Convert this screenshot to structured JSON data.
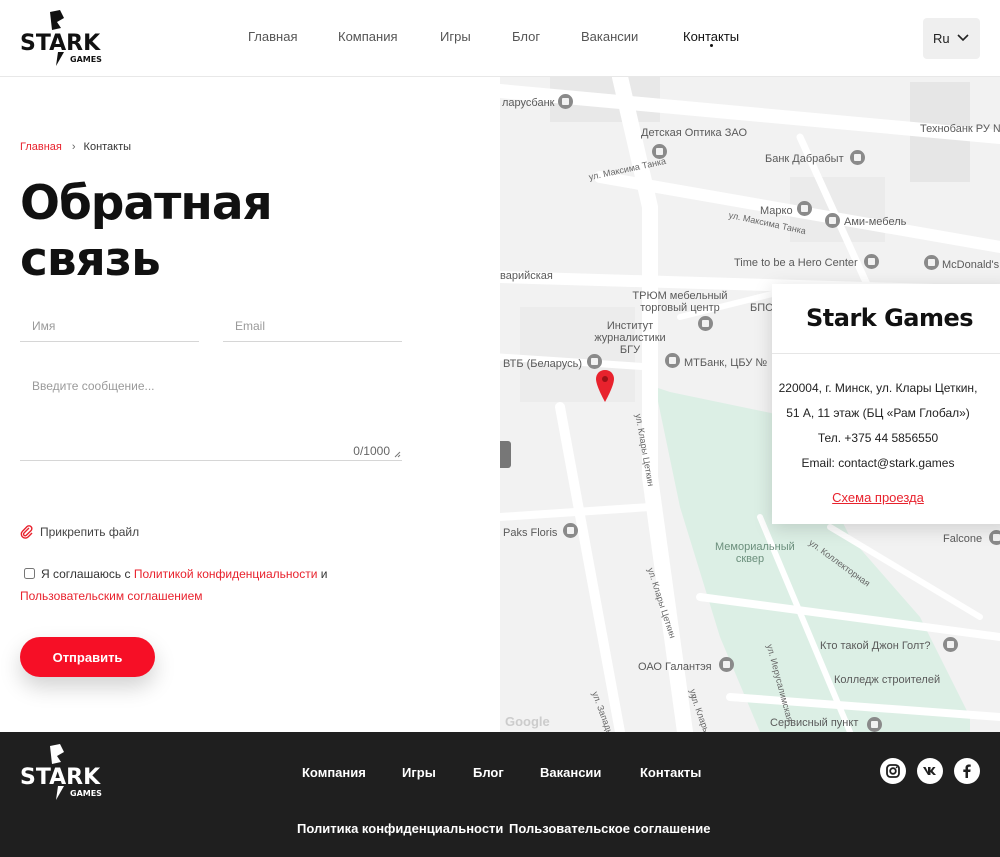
{
  "brand": {
    "logo_word": "STARK",
    "logo_sub": "GAMES"
  },
  "header": {
    "nav": [
      "Главная",
      "Компания",
      "Игры",
      "Блог",
      "Вакансии",
      "Контакты"
    ],
    "active": "Контакты",
    "lang": "Ru"
  },
  "breadcrumb": {
    "home": "Главная",
    "current": "Контакты"
  },
  "form": {
    "title_line1": "Обратная",
    "title_line2": "связь",
    "name_placeholder": "Имя",
    "email_placeholder": "Email",
    "message_placeholder": "Введите сообщение...",
    "counter": "0/1000",
    "attach": "Прикрепить файл",
    "agree_prefix": "Я соглашаюсь с",
    "privacy_link": "Политикой конфиденциальности",
    "agree_and": "и",
    "terms_link": "Пользовательским соглашением",
    "submit": "Отправить"
  },
  "map": {
    "labels": {
      "l1": "ларусбанк",
      "l2": "Детская Оптика ЗАО",
      "l3": "Технобанк РУ №",
      "l4": "Банк Дабрабыт",
      "l5": "Марко",
      "l6": "Ами-мебель",
      "l7": "Time to be a Hero Center",
      "l8": "McDonald's",
      "l9": "ТРЮМ мебельный торговый центр",
      "l10": "БПС",
      "l11": "Институт журналистики БГУ",
      "l12": "ВТБ (Беларусь)",
      "l13": "МТБанк, ЦБУ №",
      "l14": "Paks Floris",
      "l15": "Мемориальный сквер",
      "l16": "Falcone",
      "l17": "Кто такой Джон Голт?",
      "l18": "ОАО Галантэя",
      "l19": "Колледж строителей",
      "l20": "Сервисный пункт",
      "s1": "ул. Максима Танка",
      "s2": "ул. Максима Танка",
      "s3": "варийская",
      "s4": "ул. Клары Цеткин",
      "s5": "ул. Клары Цеткин",
      "s6": "ул. Коллекторная",
      "s7": "ул. Иерусалимская",
      "s8": "ул. Западн",
      "s9": "ул.",
      "s10": "ул. Кларь",
      "google": "Google"
    }
  },
  "card": {
    "title": "Stark Games",
    "address1": "220004, г. Минск, ул. Клары Цеткин,",
    "address2": "51 А, 11 этаж (БЦ «Рам Глобал»)",
    "phone": "Тел. +375 44 5856550",
    "email": "Email: contact@stark.games",
    "route_link": "Схема проезда"
  },
  "footer": {
    "nav": [
      "Компания",
      "Игры",
      "Блог",
      "Вакансии",
      "Контакты"
    ],
    "privacy": "Политика конфиденциальности",
    "terms": "Пользовательское соглашение",
    "social": [
      "instagram-icon",
      "vk-icon",
      "facebook-icon"
    ]
  },
  "colors": {
    "accent": "#f60f26",
    "link": "#e8222d",
    "footer_bg": "#1f1f1f",
    "park": "#dcefe5"
  }
}
